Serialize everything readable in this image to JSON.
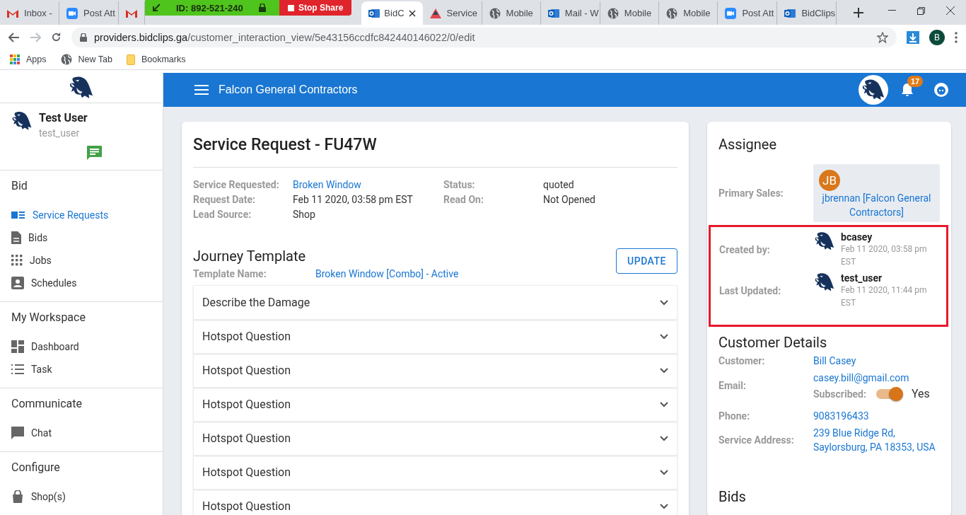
{
  "browser": {
    "tabs": [
      {
        "kind": "gmail",
        "title": "Inbox -",
        "selected": false
      },
      {
        "kind": "zoom",
        "title": "Post Att",
        "selected": false
      },
      {
        "kind": "gmail",
        "selected": false
      },
      {
        "kind": "outlook",
        "title": "BidC",
        "selected": true
      },
      {
        "kind": "service",
        "title": "Service",
        "selected": false
      },
      {
        "kind": "globe",
        "title": "Mobile",
        "selected": false
      },
      {
        "kind": "outlook",
        "title": "Mail - W",
        "selected": false
      },
      {
        "kind": "globe",
        "title": "Mobile",
        "selected": false
      },
      {
        "kind": "globe",
        "title": "Mobile",
        "selected": false
      },
      {
        "kind": "zoom",
        "title": "Post Att",
        "selected": false
      },
      {
        "kind": "outlook",
        "title": "BidClips",
        "selected": false
      }
    ],
    "share_bar": {
      "meeting_id": "ID: 892-521-240",
      "stop_button": "Stop Share"
    },
    "address": {
      "host": "providers.bidclips.ga",
      "path": "/customer_interaction_view/5e43156ccdfc842440146022/0/edit"
    },
    "profile_initial": "B",
    "bookmarks": [
      {
        "kind": "apps",
        "label": "Apps"
      },
      {
        "kind": "globe",
        "label": "New Tab"
      },
      {
        "kind": "folder",
        "label": "Bookmarks"
      }
    ]
  },
  "sidebar": {
    "user": {
      "name": "Test User",
      "username": "test_user"
    },
    "sections": [
      {
        "title": "Bid",
        "items": [
          {
            "kind": "requests",
            "label": "Service Requests",
            "selected": true
          },
          {
            "kind": "bids",
            "label": "Bids",
            "selected": false
          },
          {
            "kind": "jobs",
            "label": "Jobs",
            "selected": false
          },
          {
            "kind": "schedules",
            "label": "Schedules",
            "selected": false
          }
        ]
      },
      {
        "title": "My Workspace",
        "items": [
          {
            "kind": "dashboard",
            "label": "Dashboard",
            "selected": false
          },
          {
            "kind": "tasks",
            "label": "Task",
            "selected": false
          }
        ]
      },
      {
        "title": "Communicate",
        "items": [
          {
            "kind": "chat",
            "label": "Chat",
            "selected": false
          }
        ]
      },
      {
        "title": "Configure",
        "items": [
          {
            "kind": "shop",
            "label": "Shop(s)",
            "selected": false
          }
        ]
      }
    ]
  },
  "topbar": {
    "company": "Falcon General Contractors",
    "notification_count": "17"
  },
  "request": {
    "title": "Service Request - FU47W",
    "fields": [
      {
        "label": "Service Requested:",
        "value": "Broken Window",
        "kind": "link"
      },
      {
        "label": "Status:",
        "value": "quoted",
        "kind": "text"
      },
      {
        "label": "Request Date:",
        "value": "Feb 11 2020, 03:58 pm EST",
        "kind": "text"
      },
      {
        "label": "Read On:",
        "value": "Not Opened",
        "kind": "text"
      },
      {
        "label": "Lead Source:",
        "value": "Shop",
        "kind": "text"
      }
    ],
    "journey": {
      "title": "Journey Template",
      "button": "UPDATE",
      "template_label": "Template Name:",
      "template_value": "Broken Window [Combo] - Active"
    },
    "questions": [
      {
        "label": "Describe the Damage",
        "expanded": false
      },
      {
        "label": "Hotspot Question",
        "expanded": false
      },
      {
        "label": "Hotspot Question",
        "expanded": false
      },
      {
        "label": "Hotspot Question",
        "expanded": false
      },
      {
        "label": "Hotspot Question",
        "expanded": false
      },
      {
        "label": "Hotspot Question",
        "expanded": false
      },
      {
        "label": "Hotspot Question",
        "expanded": false
      }
    ]
  },
  "assignee": {
    "title": "Assignee",
    "primary_label": "Primary Sales:",
    "primary_initials": "JB",
    "primary_name": "jbrennan [Falcon General Contractors]",
    "audit_highlighted": true,
    "audit": [
      {
        "label": "Created by:",
        "user": "bcasey",
        "date": "Feb 11 2020, 03:58 pm EST"
      },
      {
        "label": "Last Updated:",
        "user": "test_user",
        "date": "Feb 11 2020, 11:44 pm EST"
      }
    ]
  },
  "customer": {
    "title": "Customer Details",
    "customer_label": "Customer:",
    "customer_name": "Bill Casey",
    "email_label": "Email:",
    "email": "casey.bill@gmail.com",
    "subscribed_label": "Subscribed:",
    "subscribed": true,
    "subscribed_text": "Yes",
    "phone_label": "Phone:",
    "phone": "9083196433",
    "address_label": "Service Address:",
    "address": "239 Blue Ridge Rd, Saylorsburg, PA 18353, USA"
  },
  "bids": {
    "title": "Bids"
  }
}
